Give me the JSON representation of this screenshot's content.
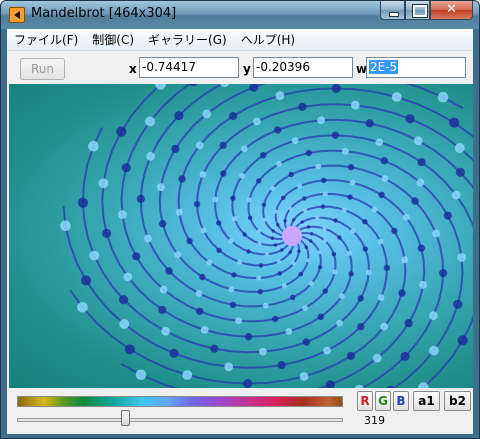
{
  "window": {
    "title": "Mandelbrot  [464x304]"
  },
  "menu": {
    "items": [
      "ファイル(F)",
      "制御(C)",
      "ギャラリー(G)",
      "ヘルプ(H)"
    ]
  },
  "toolbar": {
    "run_label": "Run",
    "x_label": "x",
    "x_value": "-0.74417",
    "y_label": "y",
    "y_value": "-0.20396",
    "w_label": "w",
    "w_value": "2E-5"
  },
  "controls": {
    "r_label": "R",
    "g_label": "G",
    "b_label": "B",
    "a1_label": "a1",
    "b2_label": "b2",
    "slider_value": "319",
    "slider_fraction": 0.33
  },
  "colors": {
    "r": "#d02020",
    "g": "#208a20",
    "b": "#2040c0",
    "fractal_core": "#1a2a9a",
    "fractal_glow": "#7fd3ff"
  },
  "icons": [
    "app-icon",
    "minimize-icon",
    "maximize-icon",
    "close-icon"
  ]
}
